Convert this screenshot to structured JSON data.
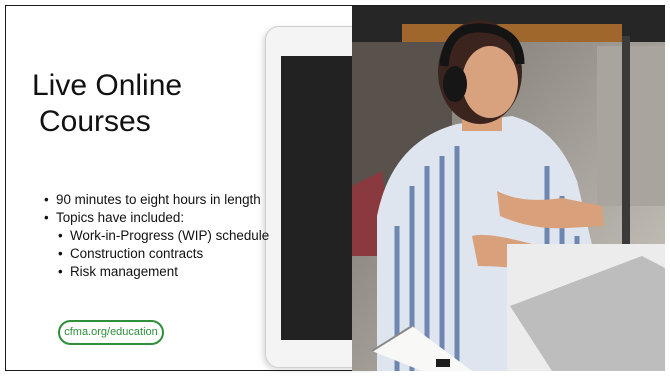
{
  "slide": {
    "title_line1": "Live Online",
    "title_line2": "Courses",
    "bullets": [
      "90 minutes to eight hours in length",
      "Topics have included:"
    ],
    "sub_bullets": [
      "Work-in-Progress (WIP) schedule",
      "Construction contracts",
      "Risk management"
    ],
    "link_badge": "cfma.org/education"
  },
  "colors": {
    "accent": "#2f8f3a"
  },
  "photo": {
    "subject": "woman-with-headphones-at-laptop-icon"
  }
}
